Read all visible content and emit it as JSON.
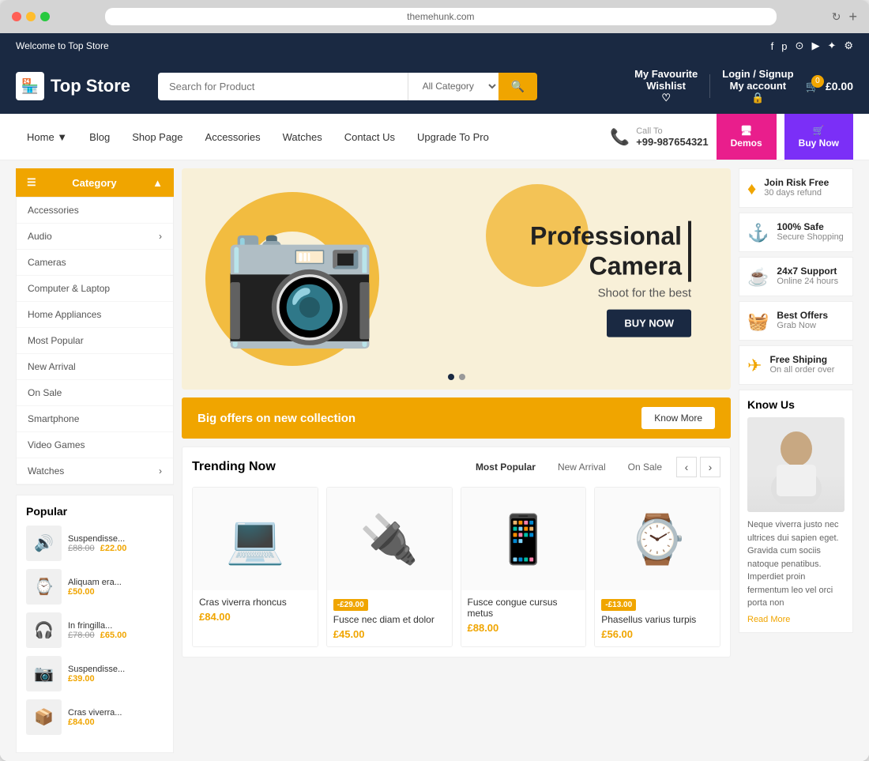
{
  "browser": {
    "url": "themehunk.com",
    "reload_icon": "↻"
  },
  "topbar": {
    "welcome": "Welcome to Top Store",
    "social": [
      "f",
      "p",
      "⊙",
      "▶",
      "✦",
      "⚙"
    ]
  },
  "header": {
    "logo_text": "Top Store",
    "logo_icon": "🏪",
    "search_placeholder": "Search for Product",
    "search_category": "All Category",
    "search_icon": "🔍",
    "wishlist_label": "My Favourite",
    "wishlist_text": "Wishlist",
    "wishlist_icon": "♡",
    "account_label": "Login / Signup",
    "account_text": "My account",
    "account_icon": "🔒",
    "cart_badge": "0",
    "cart_total": "£0.00",
    "cart_icon": "🛒"
  },
  "navbar": {
    "items": [
      {
        "label": "Home",
        "has_dropdown": true
      },
      {
        "label": "Blog",
        "has_dropdown": false
      },
      {
        "label": "Shop Page",
        "has_dropdown": false
      },
      {
        "label": "Accessories",
        "has_dropdown": false
      },
      {
        "label": "Watches",
        "has_dropdown": false
      },
      {
        "label": "Contact Us",
        "has_dropdown": false
      },
      {
        "label": "Upgrade To Pro",
        "has_dropdown": false
      }
    ],
    "call_to": "Call To",
    "phone": "+99-987654321",
    "demos_btn": "Demos",
    "buy_btn": "Buy Now"
  },
  "sidebar": {
    "category_header": "Category",
    "categories": [
      {
        "label": "Accessories",
        "has_arrow": false
      },
      {
        "label": "Audio",
        "has_arrow": true
      },
      {
        "label": "Cameras",
        "has_arrow": false
      },
      {
        "label": "Computer & Laptop",
        "has_arrow": false
      },
      {
        "label": "Home Appliances",
        "has_arrow": false
      },
      {
        "label": "Most Popular",
        "has_arrow": false
      },
      {
        "label": "New Arrival",
        "has_arrow": false
      },
      {
        "label": "On Sale",
        "has_arrow": false
      },
      {
        "label": "Smartphone",
        "has_arrow": false
      },
      {
        "label": "Video Games",
        "has_arrow": false
      },
      {
        "label": "Watches",
        "has_arrow": true
      }
    ],
    "popular_title": "Popular",
    "popular_items": [
      {
        "name": "Suspendisse...",
        "price_old": "£88.00",
        "price_new": "£22.00",
        "icon": "🔊"
      },
      {
        "name": "Aliquam era...",
        "price_new": "£50.00",
        "icon": "⌚"
      },
      {
        "name": "In fringilla...",
        "price_old": "£78.00",
        "price_new": "£65.00",
        "icon": "🎧"
      },
      {
        "name": "Suspendisse...",
        "price_new": "£39.00",
        "icon": "📷"
      },
      {
        "name": "Cras viverra...",
        "price_new": "£84.00",
        "icon": "📦"
      }
    ]
  },
  "hero": {
    "title": "Professional\nCamera",
    "subtitle": "Shoot for the best",
    "cta": "BUY NOW",
    "dot1": true,
    "dot2": false
  },
  "offers_banner": {
    "text": "Big offers on new collection",
    "btn": "Know More"
  },
  "trending": {
    "title": "Trending Now",
    "filters": [
      "Most Popular",
      "New Arrival",
      "On Sale"
    ],
    "active_filter": "Most Popular",
    "products": [
      {
        "name": "Cras viverra rhoncus",
        "price": "£84.00",
        "icon": "💻",
        "discount": ""
      },
      {
        "name": "Fusce nec diam et dolor",
        "price": "£45.00",
        "icon": "🔌",
        "discount": "-£29.00"
      },
      {
        "name": "Fusce congue cursus metus",
        "price": "£88.00",
        "icon": "📱",
        "discount": ""
      },
      {
        "name": "Phasellus varius turpis",
        "price": "£56.00",
        "icon": "⌚",
        "discount": "-£13.00"
      }
    ]
  },
  "features": [
    {
      "icon": "♦",
      "title": "Join Risk Free",
      "subtitle": "30 days refund"
    },
    {
      "icon": "⚓",
      "title": "100% Safe",
      "subtitle": "Secure Shopping"
    },
    {
      "icon": "☕",
      "title": "24x7 Support",
      "subtitle": "Online 24 hours"
    },
    {
      "icon": "🧺",
      "title": "Best Offers",
      "subtitle": "Grab Now"
    },
    {
      "icon": "✈",
      "title": "Free Shiping",
      "subtitle": "On all order over"
    }
  ],
  "know_us": {
    "title": "Know Us",
    "description": "Neque viverra justo nec ultrices dui sapien eget. Gravida cum sociis natoque penatibus. Imperdiet proin fermentum leo vel orci porta non",
    "read_more": "Read More"
  }
}
